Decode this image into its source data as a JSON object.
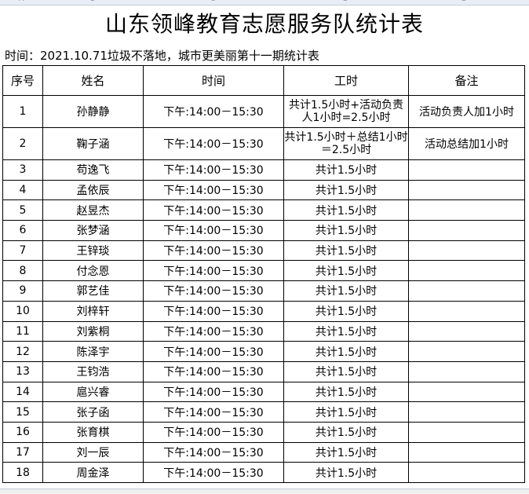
{
  "sheet": {
    "column_letters": [
      "A",
      "B",
      "C",
      "D",
      "E"
    ],
    "title": "山东领峰教育志愿服务队统计表",
    "subtitle": "时间：2021.10.71垃圾不落地，城市更美丽第十一期统计表",
    "headers": {
      "no": "序号",
      "name": "姓名",
      "time": "时间",
      "hours": "工时",
      "remark": "备注"
    },
    "rows": [
      {
        "no": "1",
        "name": "孙静静",
        "time": "下午:14:00－15:30",
        "hours": "共计1.5小时+活动负责人1小时=2.5小时",
        "remark": "活动负责人加1小时"
      },
      {
        "no": "2",
        "name": "鞠子涵",
        "time": "下午:14:00－15:30",
        "hours": "共计1.5小时＋总结1小时＝2.5小时",
        "remark": "活动总结加1小时"
      },
      {
        "no": "3",
        "name": "苟逸飞",
        "time": "下午:14:00－15:30",
        "hours": "共计1.5小时",
        "remark": ""
      },
      {
        "no": "4",
        "name": "孟依辰",
        "time": "下午:14:00－15:30",
        "hours": "共计1.5小时",
        "remark": ""
      },
      {
        "no": "5",
        "name": "赵昱杰",
        "time": "下午:14:00－15:30",
        "hours": "共计1.5小时",
        "remark": ""
      },
      {
        "no": "6",
        "name": "张梦涵",
        "time": "下午:14:00－15:30",
        "hours": "共计1.5小时",
        "remark": ""
      },
      {
        "no": "7",
        "name": "王锌琰",
        "time": "下午:14:00－15:30",
        "hours": "共计1.5小时",
        "remark": ""
      },
      {
        "no": "8",
        "name": "付念恩",
        "time": "下午:14:00－15:30",
        "hours": "共计1.5小时",
        "remark": ""
      },
      {
        "no": "9",
        "name": "郭艺佳",
        "time": "下午:14:00－15:30",
        "hours": "共计1.5小时",
        "remark": ""
      },
      {
        "no": "10",
        "name": "刘梓轩",
        "time": "下午:14:00－15:30",
        "hours": "共计1.5小时",
        "remark": ""
      },
      {
        "no": "11",
        "name": "刘紫桐",
        "time": "下午:14:00－15:30",
        "hours": "共计1.5小时",
        "remark": ""
      },
      {
        "no": "12",
        "name": "陈泽宇",
        "time": "下午:14:00－15:30",
        "hours": "共计1.5小时",
        "remark": ""
      },
      {
        "no": "13",
        "name": "王钧浩",
        "time": "下午:14:00－15:30",
        "hours": "共计1.5小时",
        "remark": ""
      },
      {
        "no": "14",
        "name": "扈兴睿",
        "time": "下午:14:00－15:30",
        "hours": "共计1.5小时",
        "remark": ""
      },
      {
        "no": "15",
        "name": "张子函",
        "time": "下午:14:00－15:30",
        "hours": "共计1.5小时",
        "remark": ""
      },
      {
        "no": "16",
        "name": "张育棋",
        "time": "下午:14:00－15:30",
        "hours": "共计1.5小时",
        "remark": ""
      },
      {
        "no": "17",
        "name": "刘一辰",
        "time": "下午:14:00－15:30",
        "hours": "共计1.5小时",
        "remark": ""
      },
      {
        "no": "18",
        "name": "周金泽",
        "time": "下午:14:00－15:30",
        "hours": "共计1.5小时",
        "remark": ""
      }
    ]
  }
}
